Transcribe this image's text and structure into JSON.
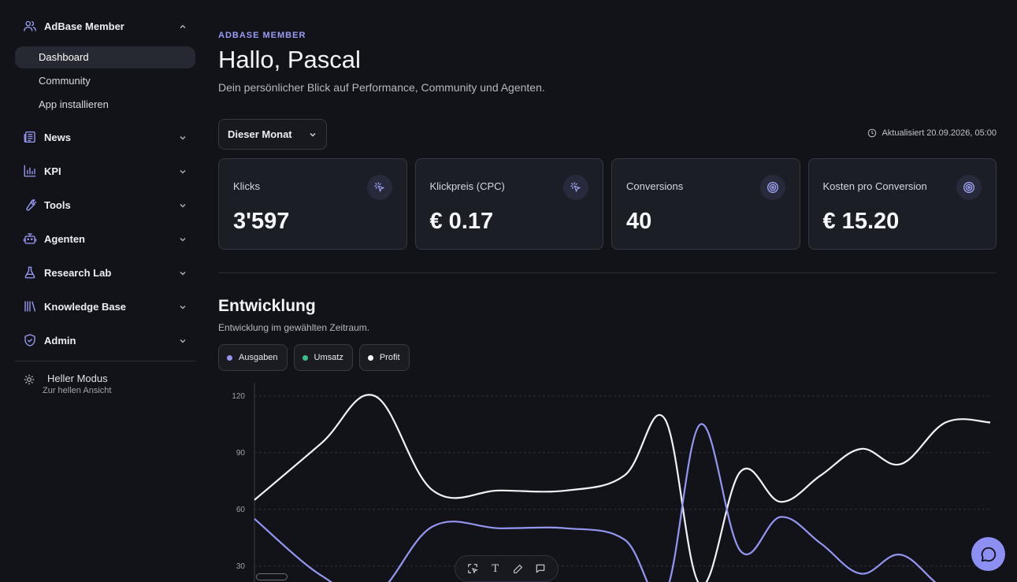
{
  "sidebar": {
    "member_group": {
      "label": "AdBase Member",
      "icon": "users-icon"
    },
    "sub_items": [
      {
        "label": "Dashboard",
        "active": true
      },
      {
        "label": "Community",
        "active": false
      },
      {
        "label": "App installieren",
        "active": false
      }
    ],
    "groups": [
      {
        "label": "News",
        "icon": "newspaper-icon"
      },
      {
        "label": "KPI",
        "icon": "bar-chart-icon"
      },
      {
        "label": "Tools",
        "icon": "wrench-icon"
      },
      {
        "label": "Agenten",
        "icon": "robot-icon"
      },
      {
        "label": "Research Lab",
        "icon": "flask-icon"
      },
      {
        "label": "Knowledge Base",
        "icon": "library-icon"
      },
      {
        "label": "Admin",
        "icon": "shield-icon"
      }
    ],
    "mode": {
      "title": "Heller Modus",
      "subtitle": "Zur hellen Ansicht"
    }
  },
  "header": {
    "eyebrow": "ADBASE MEMBER",
    "title": "Hallo, Pascal",
    "subtitle": "Dein persönlicher Blick auf Performance, Community und Agenten."
  },
  "filters": {
    "period": "Dieser Monat",
    "updated": "Aktualisiert 20.09.2026, 05:00"
  },
  "kpis": [
    {
      "label": "Klicks",
      "value": "3'597",
      "icon": "cursor-click-icon"
    },
    {
      "label": "Klickpreis (CPC)",
      "value": "€ 0.17",
      "icon": "cursor-click-icon"
    },
    {
      "label": "Conversions",
      "value": "40",
      "icon": "target-icon"
    },
    {
      "label": "Kosten pro Conversion",
      "value": "€ 15.20",
      "icon": "target-icon"
    }
  ],
  "development": {
    "title": "Entwicklung",
    "subtitle": "Entwicklung im gewählten Zeitraum.",
    "legend": [
      {
        "label": "Ausgaben",
        "color": "#9496f2"
      },
      {
        "label": "Umsatz",
        "color": "#3bbf8a"
      },
      {
        "label": "Profit",
        "color": "#ffffff"
      }
    ]
  },
  "chart_data": {
    "type": "line",
    "ylim": [
      20,
      122
    ],
    "yticks": [
      30,
      60,
      90,
      120
    ],
    "grid": true,
    "series": [
      {
        "name": "Profit",
        "color": "#f2f3f7",
        "x": [
          0,
          1.5,
          2.7,
          4.0,
          5.5,
          7.0,
          8.3,
          9.2,
          10.0,
          10.9,
          11.8,
          12.7,
          13.6,
          14.5,
          15.5,
          16.5
        ],
        "values": [
          65,
          95,
          120,
          70,
          70,
          70,
          78,
          108,
          20,
          80,
          64,
          78,
          92,
          84,
          106,
          106
        ]
      },
      {
        "name": "Ausgaben",
        "color": "#9496f2",
        "x": [
          0,
          1.5,
          2.7,
          4.0,
          5.5,
          7.0,
          8.3,
          9.2,
          10.0,
          10.9,
          11.8,
          12.7,
          13.6,
          14.5,
          15.5,
          16.5
        ],
        "values": [
          55,
          25,
          15,
          51,
          50,
          50,
          44,
          15,
          105,
          38,
          56,
          42,
          26,
          36,
          18,
          18
        ]
      }
    ]
  },
  "toolbar": {
    "tools": [
      "select-icon",
      "text-icon",
      "pen-icon",
      "comment-icon"
    ],
    "text_glyph": "T"
  },
  "chat": {
    "icon": "chat-bubble-icon"
  }
}
